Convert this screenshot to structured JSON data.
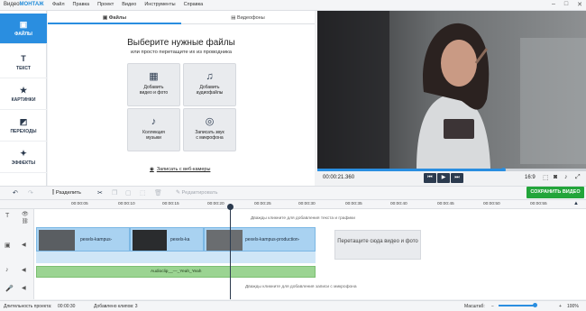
{
  "app": {
    "logo_prefix": "Видео",
    "logo_brand": "МОНТАЖ"
  },
  "menu": [
    "Файл",
    "Правка",
    "Проект",
    "Видео",
    "Инструменты",
    "Справка"
  ],
  "sidebar": [
    {
      "label": "ФАЙЛЫ",
      "icon": "files-icon",
      "glyph": "▣"
    },
    {
      "label": "ТЕКСТ",
      "icon": "text-icon",
      "glyph": "T"
    },
    {
      "label": "КАРТИНКИ",
      "icon": "star-icon",
      "glyph": "★"
    },
    {
      "label": "ПЕРЕХОДЫ",
      "icon": "transitions-icon",
      "glyph": "◩"
    },
    {
      "label": "ЭФФЕКТЫ",
      "icon": "magic-wand-icon",
      "glyph": "✦"
    }
  ],
  "tabs": [
    {
      "label": "Файлы"
    },
    {
      "label": "Видеофоны"
    }
  ],
  "panel": {
    "title": "Выберите нужные файлы",
    "subtitle": "или просто перетащите их из проводника"
  },
  "tiles": [
    {
      "l1": "Добавить",
      "l2": "видео и фото",
      "icon": "film-icon",
      "glyph": "🎞"
    },
    {
      "l1": "Добавить",
      "l2": "аудиофайлы",
      "icon": "audio-file-icon",
      "glyph": "♫"
    },
    {
      "l1": "Коллекция",
      "l2": "музыки",
      "icon": "music-note-icon",
      "glyph": "♪"
    },
    {
      "l1": "Записать звук",
      "l2": "с микрофона",
      "icon": "microphone-icon",
      "glyph": "🎤"
    }
  ],
  "webcam": "Записать с веб-камеры",
  "player": {
    "timecode": "00:00:21.360",
    "ratio": "16:9",
    "progress": 0.69
  },
  "toolbar": {
    "split": "Разделить",
    "edit": "Редактировать",
    "save": "СОХРАНИТЬ ВИДЕО"
  },
  "ruler": [
    "00:00:05",
    "00:00:10",
    "00:00:15",
    "00:00:20",
    "00:00:25",
    "00:00:30",
    "00:00:35",
    "00:00:40",
    "00:00:45",
    "00:00:50",
    "00:00:55"
  ],
  "timeline": {
    "text_hint": "Дважды кликните для добавления текста и графики",
    "clips": [
      {
        "name": "pexels-kampus-"
      },
      {
        "name": "pexels-ka"
      },
      {
        "name": "pexels-kampus-production-"
      }
    ],
    "drop": "Перетащите сюда видео и фото",
    "audio": "Audioclip__—_Yeah_Yeah",
    "mic_hint": "Дважды кликните для добавления записи с микрофона"
  },
  "status": {
    "duration_label": "Длительность проекта:",
    "duration": "00:00:30",
    "added": "Добавлено клипов: 3",
    "zoom_label": "Масштаб:",
    "zoom": "100%"
  },
  "colors": {
    "accent": "#2a8ee0",
    "save": "#22a53a",
    "video_clip": "#a9d2f1",
    "audio_clip": "#9bd492"
  }
}
